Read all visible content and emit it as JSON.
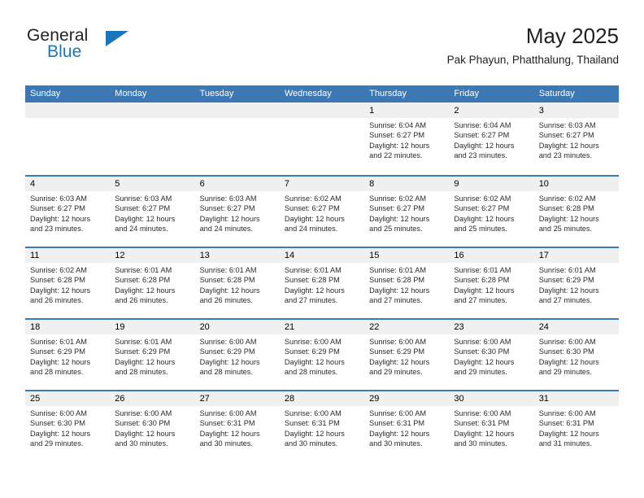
{
  "brand": {
    "word1": "General",
    "word2": "Blue",
    "accent_color": "#1b75bb"
  },
  "header": {
    "title": "May 2025",
    "subtitle": "Pak Phayun, Phatthalung, Thailand"
  },
  "theme": {
    "header_bg": "#3b78b4",
    "header_text": "#ffffff",
    "daynum_bg": "#f0f0f0",
    "cell_bg": "#ffffff"
  },
  "weekdays": [
    "Sunday",
    "Monday",
    "Tuesday",
    "Wednesday",
    "Thursday",
    "Friday",
    "Saturday"
  ],
  "labels": {
    "sunrise": "Sunrise:",
    "sunset": "Sunset:",
    "daylight": "Daylight:"
  },
  "weeks": [
    [
      {
        "day": "",
        "blank": true
      },
      {
        "day": "",
        "blank": true
      },
      {
        "day": "",
        "blank": true
      },
      {
        "day": "",
        "blank": true
      },
      {
        "day": "1",
        "sunrise": "Sunrise: 6:04 AM",
        "sunset": "Sunset: 6:27 PM",
        "daylight1": "Daylight: 12 hours",
        "daylight2": "and 22 minutes."
      },
      {
        "day": "2",
        "sunrise": "Sunrise: 6:04 AM",
        "sunset": "Sunset: 6:27 PM",
        "daylight1": "Daylight: 12 hours",
        "daylight2": "and 23 minutes."
      },
      {
        "day": "3",
        "sunrise": "Sunrise: 6:03 AM",
        "sunset": "Sunset: 6:27 PM",
        "daylight1": "Daylight: 12 hours",
        "daylight2": "and 23 minutes."
      }
    ],
    [
      {
        "day": "4",
        "sunrise": "Sunrise: 6:03 AM",
        "sunset": "Sunset: 6:27 PM",
        "daylight1": "Daylight: 12 hours",
        "daylight2": "and 23 minutes."
      },
      {
        "day": "5",
        "sunrise": "Sunrise: 6:03 AM",
        "sunset": "Sunset: 6:27 PM",
        "daylight1": "Daylight: 12 hours",
        "daylight2": "and 24 minutes."
      },
      {
        "day": "6",
        "sunrise": "Sunrise: 6:03 AM",
        "sunset": "Sunset: 6:27 PM",
        "daylight1": "Daylight: 12 hours",
        "daylight2": "and 24 minutes."
      },
      {
        "day": "7",
        "sunrise": "Sunrise: 6:02 AM",
        "sunset": "Sunset: 6:27 PM",
        "daylight1": "Daylight: 12 hours",
        "daylight2": "and 24 minutes."
      },
      {
        "day": "8",
        "sunrise": "Sunrise: 6:02 AM",
        "sunset": "Sunset: 6:27 PM",
        "daylight1": "Daylight: 12 hours",
        "daylight2": "and 25 minutes."
      },
      {
        "day": "9",
        "sunrise": "Sunrise: 6:02 AM",
        "sunset": "Sunset: 6:27 PM",
        "daylight1": "Daylight: 12 hours",
        "daylight2": "and 25 minutes."
      },
      {
        "day": "10",
        "sunrise": "Sunrise: 6:02 AM",
        "sunset": "Sunset: 6:28 PM",
        "daylight1": "Daylight: 12 hours",
        "daylight2": "and 25 minutes."
      }
    ],
    [
      {
        "day": "11",
        "sunrise": "Sunrise: 6:02 AM",
        "sunset": "Sunset: 6:28 PM",
        "daylight1": "Daylight: 12 hours",
        "daylight2": "and 26 minutes."
      },
      {
        "day": "12",
        "sunrise": "Sunrise: 6:01 AM",
        "sunset": "Sunset: 6:28 PM",
        "daylight1": "Daylight: 12 hours",
        "daylight2": "and 26 minutes."
      },
      {
        "day": "13",
        "sunrise": "Sunrise: 6:01 AM",
        "sunset": "Sunset: 6:28 PM",
        "daylight1": "Daylight: 12 hours",
        "daylight2": "and 26 minutes."
      },
      {
        "day": "14",
        "sunrise": "Sunrise: 6:01 AM",
        "sunset": "Sunset: 6:28 PM",
        "daylight1": "Daylight: 12 hours",
        "daylight2": "and 27 minutes."
      },
      {
        "day": "15",
        "sunrise": "Sunrise: 6:01 AM",
        "sunset": "Sunset: 6:28 PM",
        "daylight1": "Daylight: 12 hours",
        "daylight2": "and 27 minutes."
      },
      {
        "day": "16",
        "sunrise": "Sunrise: 6:01 AM",
        "sunset": "Sunset: 6:28 PM",
        "daylight1": "Daylight: 12 hours",
        "daylight2": "and 27 minutes."
      },
      {
        "day": "17",
        "sunrise": "Sunrise: 6:01 AM",
        "sunset": "Sunset: 6:29 PM",
        "daylight1": "Daylight: 12 hours",
        "daylight2": "and 27 minutes."
      }
    ],
    [
      {
        "day": "18",
        "sunrise": "Sunrise: 6:01 AM",
        "sunset": "Sunset: 6:29 PM",
        "daylight1": "Daylight: 12 hours",
        "daylight2": "and 28 minutes."
      },
      {
        "day": "19",
        "sunrise": "Sunrise: 6:01 AM",
        "sunset": "Sunset: 6:29 PM",
        "daylight1": "Daylight: 12 hours",
        "daylight2": "and 28 minutes."
      },
      {
        "day": "20",
        "sunrise": "Sunrise: 6:00 AM",
        "sunset": "Sunset: 6:29 PM",
        "daylight1": "Daylight: 12 hours",
        "daylight2": "and 28 minutes."
      },
      {
        "day": "21",
        "sunrise": "Sunrise: 6:00 AM",
        "sunset": "Sunset: 6:29 PM",
        "daylight1": "Daylight: 12 hours",
        "daylight2": "and 28 minutes."
      },
      {
        "day": "22",
        "sunrise": "Sunrise: 6:00 AM",
        "sunset": "Sunset: 6:29 PM",
        "daylight1": "Daylight: 12 hours",
        "daylight2": "and 29 minutes."
      },
      {
        "day": "23",
        "sunrise": "Sunrise: 6:00 AM",
        "sunset": "Sunset: 6:30 PM",
        "daylight1": "Daylight: 12 hours",
        "daylight2": "and 29 minutes."
      },
      {
        "day": "24",
        "sunrise": "Sunrise: 6:00 AM",
        "sunset": "Sunset: 6:30 PM",
        "daylight1": "Daylight: 12 hours",
        "daylight2": "and 29 minutes."
      }
    ],
    [
      {
        "day": "25",
        "sunrise": "Sunrise: 6:00 AM",
        "sunset": "Sunset: 6:30 PM",
        "daylight1": "Daylight: 12 hours",
        "daylight2": "and 29 minutes."
      },
      {
        "day": "26",
        "sunrise": "Sunrise: 6:00 AM",
        "sunset": "Sunset: 6:30 PM",
        "daylight1": "Daylight: 12 hours",
        "daylight2": "and 30 minutes."
      },
      {
        "day": "27",
        "sunrise": "Sunrise: 6:00 AM",
        "sunset": "Sunset: 6:31 PM",
        "daylight1": "Daylight: 12 hours",
        "daylight2": "and 30 minutes."
      },
      {
        "day": "28",
        "sunrise": "Sunrise: 6:00 AM",
        "sunset": "Sunset: 6:31 PM",
        "daylight1": "Daylight: 12 hours",
        "daylight2": "and 30 minutes."
      },
      {
        "day": "29",
        "sunrise": "Sunrise: 6:00 AM",
        "sunset": "Sunset: 6:31 PM",
        "daylight1": "Daylight: 12 hours",
        "daylight2": "and 30 minutes."
      },
      {
        "day": "30",
        "sunrise": "Sunrise: 6:00 AM",
        "sunset": "Sunset: 6:31 PM",
        "daylight1": "Daylight: 12 hours",
        "daylight2": "and 30 minutes."
      },
      {
        "day": "31",
        "sunrise": "Sunrise: 6:00 AM",
        "sunset": "Sunset: 6:31 PM",
        "daylight1": "Daylight: 12 hours",
        "daylight2": "and 31 minutes."
      }
    ]
  ]
}
